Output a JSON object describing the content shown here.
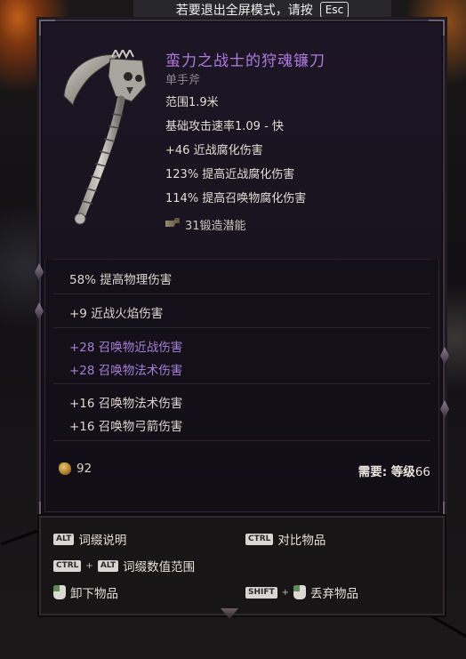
{
  "toast": {
    "text": "若要退出全屏模式，请按",
    "key": "Esc"
  },
  "item": {
    "name": "蛮力之战士的狩魂镰刀",
    "type": "单手斧",
    "stats": [
      "范围1.9米",
      "基础攻击速率1.09 - 快",
      "+46 近战腐化伤害",
      "123% 提高近战腐化伤害",
      "114% 提高召唤物腐化伤害"
    ],
    "forge_potential": "31锻造潜能",
    "affix_groups": [
      {
        "color": "white",
        "lines": [
          "58% 提高物理伤害"
        ]
      },
      {
        "color": "white",
        "lines": [
          "+9 近战火焰伤害"
        ]
      },
      {
        "color": "purple",
        "lines": [
          "+28 召唤物近战伤害",
          "+28 召唤物法术伤害"
        ]
      },
      {
        "color": "white",
        "lines": [
          "+16 召唤物法术伤害",
          "+16 召唤物弓箭伤害"
        ]
      }
    ],
    "gold_value": "92",
    "requirement_label": "需要: 等级",
    "requirement_value": "66"
  },
  "controls": {
    "alt_key": "ALT",
    "ctrl_key": "CTRL",
    "shift_key": "SHIFT",
    "plus": "+",
    "affix_info": "词缀说明",
    "compare": "对比物品",
    "affix_ranges": "词缀数值范围",
    "unequip": "卸下物品",
    "drop": "丢弃物品"
  },
  "colors": {
    "name": "#b07ae0",
    "purple_affix": "#a680d8",
    "text": "#e2dcd4"
  },
  "icons": {
    "weapon": "scythe-icon",
    "forge": "anvil-icon",
    "gold": "gold-icon",
    "mouse": "mouse-left-icon"
  }
}
